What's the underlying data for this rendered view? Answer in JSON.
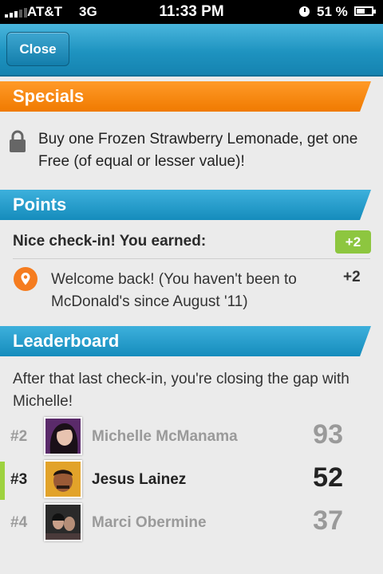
{
  "status_bar": {
    "carrier": "AT&T",
    "network": "3G",
    "time": "11:33 PM",
    "battery_percent": "51 %",
    "battery_level": 0.51
  },
  "nav": {
    "close_label": "Close"
  },
  "specials": {
    "title": "Specials",
    "text": "Buy one Frozen Strawberry Lemonade, get one Free (of equal or lesser value)!",
    "icon": "lock-icon"
  },
  "points": {
    "title": "Points",
    "earned_label": "Nice check-in! You earned:",
    "earned_badge": "+2",
    "reason": "Welcome back! (You haven't been to McDonald's since August '11)",
    "reason_points": "+2",
    "icon": "location-pin-icon"
  },
  "leaderboard": {
    "title": "Leaderboard",
    "message": "After that last check-in, you're closing the gap with Michelle!",
    "rows": [
      {
        "rank": "#2",
        "name": "Michelle McManama",
        "score": "93",
        "current": false
      },
      {
        "rank": "#3",
        "name": "Jesus Lainez",
        "score": "52",
        "current": true
      },
      {
        "rank": "#4",
        "name": "Marci Obermine",
        "score": "37",
        "current": false
      }
    ]
  },
  "colors": {
    "specials_banner": "#f58a12",
    "section_banner": "#1f97c6",
    "badge_green": "#8dc63f",
    "pin_orange": "#f57c1f"
  }
}
